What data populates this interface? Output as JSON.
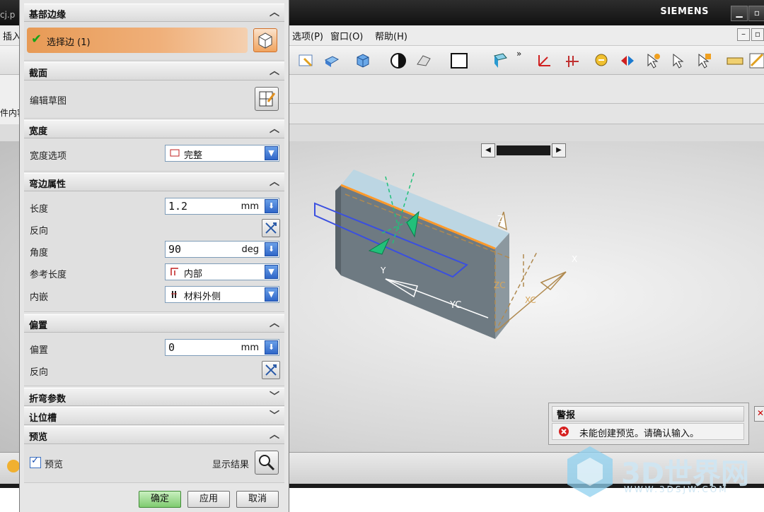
{
  "app": {
    "brand": "SIEMENS",
    "file_tab_fragment": "cj.p",
    "menu": [
      {
        "label": "插入"
      },
      {
        "label": "选项(P)"
      },
      {
        "label": "窗口(O)"
      },
      {
        "label": "帮助(H)"
      }
    ],
    "left_fragment": "件内容",
    "viewport_labels": {
      "z": "Z",
      "x": "X",
      "y": "Y",
      "yc": "YC",
      "zc": "ZC",
      "xc": "XC"
    }
  },
  "dialog": {
    "sections": {
      "base_edge": {
        "title": "基部边缘",
        "select_label": "选择边 (1)"
      },
      "section": {
        "title": "截面",
        "edit_sketch_label": "编辑草图"
      },
      "width": {
        "title": "宽度",
        "option_label": "宽度选项",
        "option_value": "完整"
      },
      "flange": {
        "title": "弯边属性",
        "length_label": "长度",
        "length_value": "1.2",
        "length_unit": "mm",
        "reverse1_label": "反向",
        "angle_label": "角度",
        "angle_value": "90",
        "angle_unit": "deg",
        "ref_length_label": "参考长度",
        "ref_length_value": "内部",
        "inset_label": "内嵌",
        "inset_value": "材料外侧"
      },
      "offset": {
        "title": "偏置",
        "offset_label": "偏置",
        "offset_value": "0",
        "offset_unit": "mm",
        "reverse2_label": "反向"
      },
      "bend_params": {
        "title": "折弯参数"
      },
      "relief": {
        "title": "让位槽"
      },
      "preview": {
        "title": "预览",
        "checkbox_label": "预览",
        "checked": true,
        "show_result_label": "显示结果"
      }
    },
    "buttons": {
      "ok": "确定",
      "apply": "应用",
      "cancel": "取消"
    }
  },
  "warning": {
    "title": "警报",
    "message": "未能创建预览。请确认输入。"
  },
  "watermark": {
    "text": "3D世界网",
    "url": "WWW.3DSJW.COM"
  },
  "colors": {
    "select_bar": "#e79a55",
    "ok_button": "#7fcb6f",
    "dropdown_blue": "#2f66c8",
    "part_face": "#7d8a92",
    "part_top": "#b9d6e6",
    "edge_highlight": "#ff9a2a",
    "sketch_plane": "#3a4fe0",
    "direction_arrow": "#22c07a"
  }
}
